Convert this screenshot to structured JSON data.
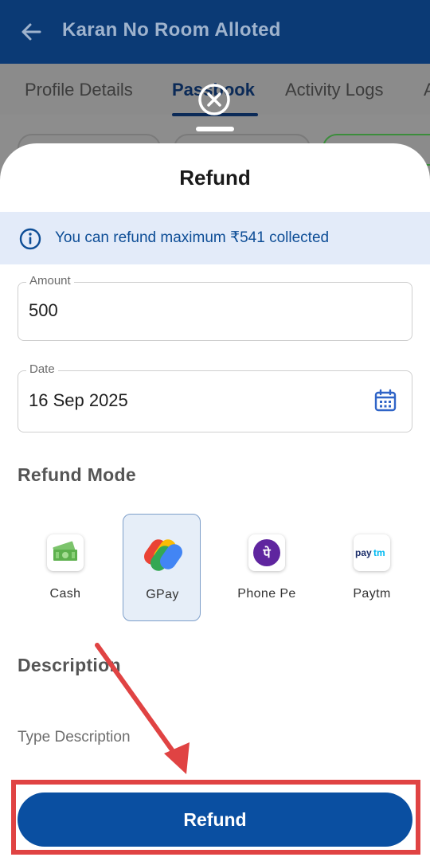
{
  "appbar": {
    "title": "Karan No Room Alloted"
  },
  "tabs": [
    {
      "label": "Profile Details"
    },
    {
      "label": "Passbook"
    },
    {
      "label": "Activity Logs"
    },
    {
      "label": "A"
    }
  ],
  "sheet": {
    "title": "Refund",
    "info": {
      "text": "You can refund maximum ₹541 collected"
    },
    "amount": {
      "label": "Amount",
      "value": "500"
    },
    "date": {
      "label": "Date",
      "value": "16 Sep 2025"
    },
    "refund_mode": {
      "heading": "Refund Mode",
      "selected": "GPay",
      "options": [
        {
          "label": "Cash",
          "icon": "cash-icon"
        },
        {
          "label": "GPay",
          "icon": "gpay-icon"
        },
        {
          "label": "Phone Pe",
          "icon": "phonepe-icon",
          "glyph": "पे"
        },
        {
          "label": "Paytm",
          "icon": "paytm-icon",
          "glyph_a": "pay",
          "glyph_b": "tm"
        }
      ]
    },
    "description": {
      "heading": "Description",
      "placeholder": "Type Description"
    },
    "submit_label": "Refund"
  },
  "colors": {
    "appbar": "#0b3a75",
    "primary": "#0a4fa1",
    "info_bg": "#e3ebf9",
    "info_text": "#0d4d96",
    "annotation": "#e04343"
  }
}
